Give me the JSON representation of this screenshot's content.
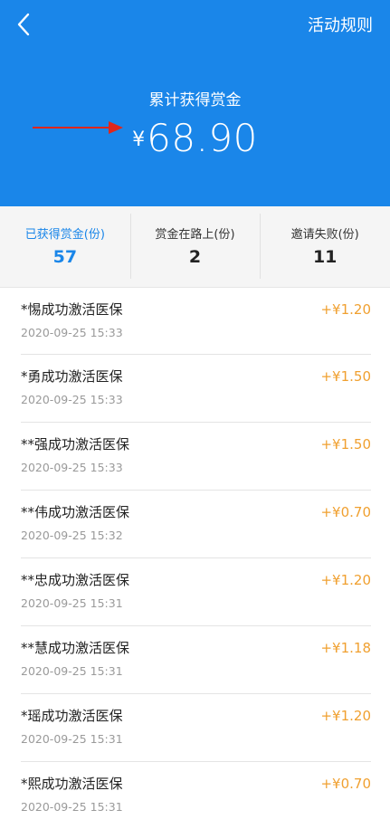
{
  "header": {
    "rules_link": "活动规则",
    "total_label": "累计获得赏金",
    "currency_symbol": "¥",
    "total_amount": "68.90",
    "accent_color": "#1a86e9"
  },
  "stats": [
    {
      "label": "已获得赏金(份)",
      "value": "57"
    },
    {
      "label": "赏金在路上(份)",
      "value": "2"
    },
    {
      "label": "邀请失败(份)",
      "value": "11"
    }
  ],
  "records": [
    {
      "title": "*惕成功激活医保",
      "time": "2020-09-25 15:33",
      "amount": "+¥1.20"
    },
    {
      "title": "*勇成功激活医保",
      "time": "2020-09-25 15:33",
      "amount": "+¥1.50"
    },
    {
      "title": "**强成功激活医保",
      "time": "2020-09-25 15:33",
      "amount": "+¥1.50"
    },
    {
      "title": "**伟成功激活医保",
      "time": "2020-09-25 15:32",
      "amount": "+¥0.70"
    },
    {
      "title": "**忠成功激活医保",
      "time": "2020-09-25 15:31",
      "amount": "+¥1.20"
    },
    {
      "title": "**慧成功激活医保",
      "time": "2020-09-25 15:31",
      "amount": "+¥1.18"
    },
    {
      "title": "*瑶成功激活医保",
      "time": "2020-09-25 15:31",
      "amount": "+¥1.20"
    },
    {
      "title": "*熙成功激活医保",
      "time": "2020-09-25 15:31",
      "amount": "+¥0.70"
    }
  ]
}
